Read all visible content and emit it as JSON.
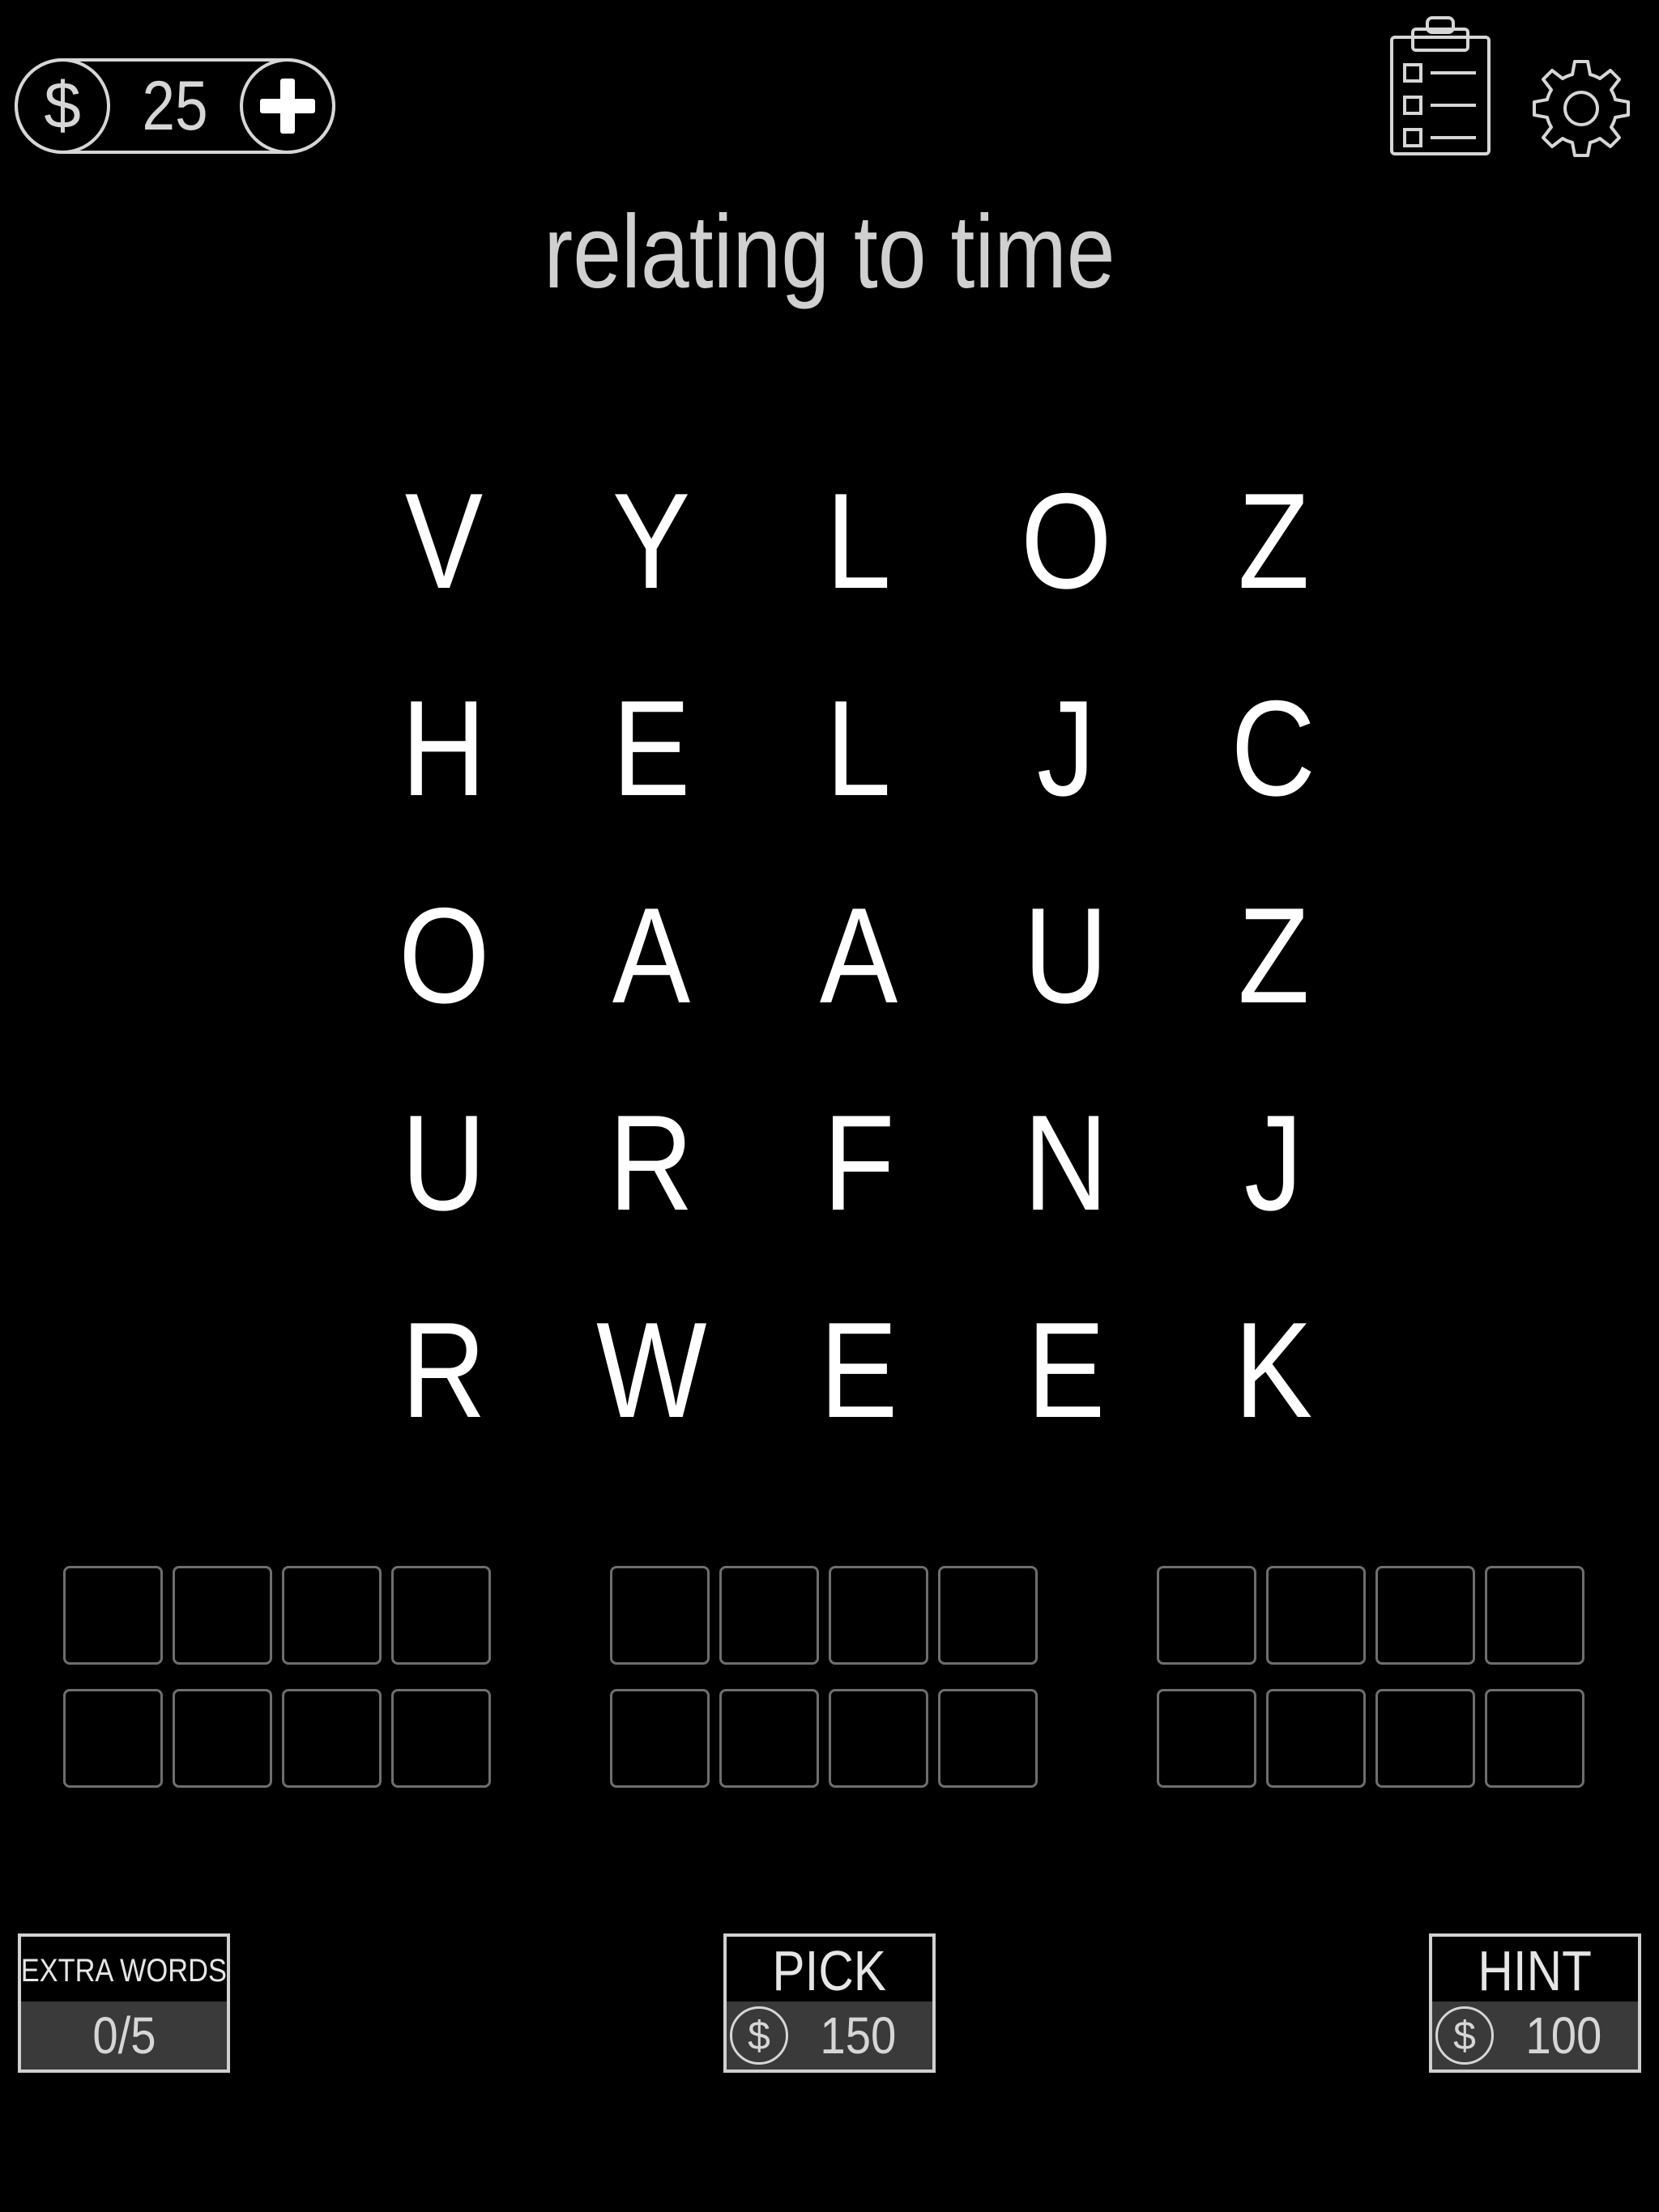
{
  "header": {
    "coins": "25",
    "currency_symbol": "$"
  },
  "puzzle": {
    "clue": "relating to time"
  },
  "grid": [
    [
      "V",
      "Y",
      "L",
      "O",
      "Z"
    ],
    [
      "H",
      "E",
      "L",
      "J",
      "C"
    ],
    [
      "O",
      "A",
      "A",
      "U",
      "Z"
    ],
    [
      "U",
      "R",
      "F",
      "N",
      "J"
    ],
    [
      "R",
      "W",
      "E",
      "E",
      "K"
    ]
  ],
  "answers": {
    "word_count": 6,
    "letters_per_word": 4,
    "filled": [
      [
        "",
        "",
        "",
        ""
      ],
      [
        "",
        "",
        "",
        ""
      ],
      [
        "",
        "",
        "",
        ""
      ],
      [
        "",
        "",
        "",
        ""
      ],
      [
        "",
        "",
        "",
        ""
      ],
      [
        "",
        "",
        "",
        ""
      ]
    ]
  },
  "buttons": {
    "extra_words": {
      "label": "EXTRA WORDS",
      "count": "0/5"
    },
    "pick": {
      "label": "PICK",
      "currency_symbol": "$",
      "price": "150"
    },
    "hint": {
      "label": "HINT",
      "currency_symbol": "$",
      "price": "100"
    }
  },
  "colors": {
    "background": "#000000",
    "letter": "#ffffff",
    "title": "#d0d0d0",
    "slot_border": "#6e6e6e",
    "button_bar": "#3a3a3a"
  },
  "icons": {
    "coin": "dollar-coin-icon",
    "add": "plus-icon",
    "tasks": "clipboard-list-icon",
    "settings": "gear-icon"
  }
}
